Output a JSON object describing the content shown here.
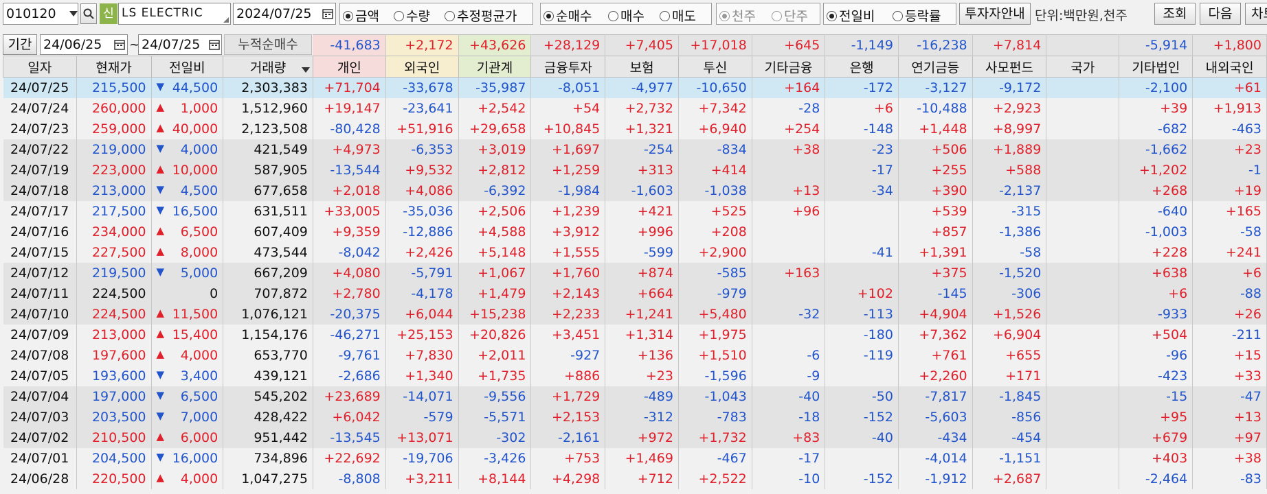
{
  "toolbar": {
    "code": "010120",
    "sin_badge": "신",
    "stock_name": "LS ELECTRIC",
    "date": "2024/07/25",
    "group1": [
      "금액",
      "수량",
      "추정평균가"
    ],
    "group1_selected": 0,
    "group2": [
      "순매수",
      "매수",
      "매도"
    ],
    "group2_selected": 0,
    "group3": [
      "천주",
      "단주"
    ],
    "group3_selected": 0,
    "group4": [
      "전일비",
      "등락률"
    ],
    "group4_selected": 0,
    "invest_guide": "투자자안내",
    "unit": "단위:백만원,천주",
    "query": "조회",
    "next": "다음",
    "chart": "차트"
  },
  "period": {
    "label": "기간",
    "from": "24/06/25",
    "sep": "~",
    "to": "24/07/25",
    "cum_label": "누적순매수",
    "cum_values": [
      "-41,683",
      "+2,172",
      "+43,626",
      "+28,129",
      "+7,405",
      "+17,018",
      "+645",
      "-1,149",
      "-16,238",
      "+7,814",
      "",
      "-5,914",
      "+1,800"
    ]
  },
  "headers": [
    "일자",
    "현재가",
    "전일비",
    "거래량",
    "개인",
    "외국인",
    "기관계",
    "금융투자",
    "보험",
    "투신",
    "기타금융",
    "은행",
    "연기금등",
    "사모펀드",
    "국가",
    "기타법인",
    "내외국인"
  ],
  "rows": [
    [
      "24/07/25",
      "215,500",
      "dn",
      "44,500",
      "2,303,383",
      "+71,704",
      "-33,678",
      "-35,987",
      "-8,051",
      "-4,977",
      "-10,650",
      "+164",
      "-172",
      "-3,127",
      "-9,172",
      "",
      "-2,100",
      "+61"
    ],
    [
      "24/07/24",
      "260,000",
      "up",
      "1,000",
      "1,512,960",
      "+19,147",
      "-23,641",
      "+2,542",
      "+54",
      "+2,732",
      "+7,342",
      "-28",
      "+6",
      "-10,488",
      "+2,923",
      "",
      "+39",
      "+1,913"
    ],
    [
      "24/07/23",
      "259,000",
      "up",
      "40,000",
      "2,123,508",
      "-80,428",
      "+51,916",
      "+29,658",
      "+10,845",
      "+1,321",
      "+6,940",
      "+254",
      "-148",
      "+1,448",
      "+8,997",
      "",
      "-682",
      "-463"
    ],
    [
      "24/07/22",
      "219,000",
      "dn",
      "4,000",
      "421,549",
      "+4,973",
      "-6,353",
      "+3,019",
      "+1,697",
      "-254",
      "-834",
      "+38",
      "-23",
      "+506",
      "+1,889",
      "",
      "-1,662",
      "+23"
    ],
    [
      "24/07/19",
      "223,000",
      "up",
      "10,000",
      "587,905",
      "-13,544",
      "+9,532",
      "+2,812",
      "+1,259",
      "+313",
      "+414",
      "",
      "-17",
      "+255",
      "+588",
      "",
      "+1,202",
      "-1"
    ],
    [
      "24/07/18",
      "213,000",
      "dn",
      "4,500",
      "677,658",
      "+2,018",
      "+4,086",
      "-6,392",
      "-1,984",
      "-1,603",
      "-1,038",
      "+13",
      "-34",
      "+390",
      "-2,137",
      "",
      "+268",
      "+19"
    ],
    [
      "24/07/17",
      "217,500",
      "dn",
      "16,500",
      "631,511",
      "+33,005",
      "-35,036",
      "+2,506",
      "+1,239",
      "+421",
      "+525",
      "+96",
      "",
      "+539",
      "-315",
      "",
      "-640",
      "+165"
    ],
    [
      "24/07/16",
      "234,000",
      "up",
      "6,500",
      "607,409",
      "+9,359",
      "-12,886",
      "+4,588",
      "+3,912",
      "+996",
      "+208",
      "",
      "",
      "+857",
      "-1,386",
      "",
      "-1,003",
      "-58"
    ],
    [
      "24/07/15",
      "227,500",
      "up",
      "8,000",
      "473,544",
      "-8,042",
      "+2,426",
      "+5,148",
      "+1,555",
      "-599",
      "+2,900",
      "",
      "-41",
      "+1,391",
      "-58",
      "",
      "+228",
      "+241"
    ],
    [
      "24/07/12",
      "219,500",
      "dn",
      "5,000",
      "667,209",
      "+4,080",
      "-5,791",
      "+1,067",
      "+1,760",
      "+874",
      "-585",
      "+163",
      "",
      "+375",
      "-1,520",
      "",
      "+638",
      "+6"
    ],
    [
      "24/07/11",
      "224,500",
      "none",
      "0",
      "707,872",
      "+2,780",
      "-4,178",
      "+1,479",
      "+2,143",
      "+664",
      "-979",
      "",
      "+102",
      "-145",
      "-306",
      "",
      "+6",
      "-88"
    ],
    [
      "24/07/10",
      "224,500",
      "up",
      "11,500",
      "1,076,121",
      "-20,375",
      "+6,044",
      "+15,238",
      "+2,233",
      "+1,241",
      "+5,480",
      "-32",
      "-113",
      "+4,904",
      "+1,526",
      "",
      "-933",
      "+26"
    ],
    [
      "24/07/09",
      "213,000",
      "up",
      "15,400",
      "1,154,176",
      "-46,271",
      "+25,153",
      "+20,826",
      "+3,451",
      "+1,314",
      "+1,975",
      "",
      "-180",
      "+7,362",
      "+6,904",
      "",
      "+504",
      "-211"
    ],
    [
      "24/07/08",
      "197,600",
      "up",
      "4,000",
      "653,770",
      "-9,761",
      "+7,830",
      "+2,011",
      "-927",
      "+136",
      "+1,510",
      "-6",
      "-119",
      "+761",
      "+655",
      "",
      "-96",
      "+15"
    ],
    [
      "24/07/05",
      "193,600",
      "dn",
      "3,400",
      "439,121",
      "-2,686",
      "+1,340",
      "+1,735",
      "+886",
      "+23",
      "-1,596",
      "-9",
      "",
      "+2,260",
      "+171",
      "",
      "-423",
      "+33"
    ],
    [
      "24/07/04",
      "197,000",
      "dn",
      "6,500",
      "545,202",
      "+23,689",
      "-14,071",
      "-9,556",
      "+1,729",
      "-489",
      "-1,043",
      "-40",
      "-50",
      "-7,817",
      "-1,845",
      "",
      "-15",
      "-47"
    ],
    [
      "24/07/03",
      "203,500",
      "dn",
      "7,000",
      "428,422",
      "+6,042",
      "-579",
      "-5,571",
      "+2,153",
      "-312",
      "-783",
      "-18",
      "-152",
      "-5,603",
      "-856",
      "",
      "+95",
      "+13"
    ],
    [
      "24/07/02",
      "210,500",
      "up",
      "6,000",
      "951,442",
      "-13,545",
      "+13,071",
      "-302",
      "-2,161",
      "+972",
      "+1,732",
      "+83",
      "-40",
      "-434",
      "-454",
      "",
      "+679",
      "+97"
    ],
    [
      "24/07/01",
      "204,500",
      "dn",
      "16,000",
      "734,896",
      "+22,692",
      "-19,706",
      "-3,426",
      "+753",
      "+1,469",
      "-467",
      "-17",
      "",
      "-4,014",
      "-1,151",
      "",
      "+403",
      "+38"
    ],
    [
      "24/06/28",
      "220,500",
      "up",
      "4,000",
      "1,047,275",
      "-8,808",
      "+3,211",
      "+8,144",
      "+4,298",
      "+712",
      "+2,522",
      "-10",
      "-152",
      "-1,912",
      "+2,687",
      "",
      "-2,464",
      "-83"
    ]
  ]
}
